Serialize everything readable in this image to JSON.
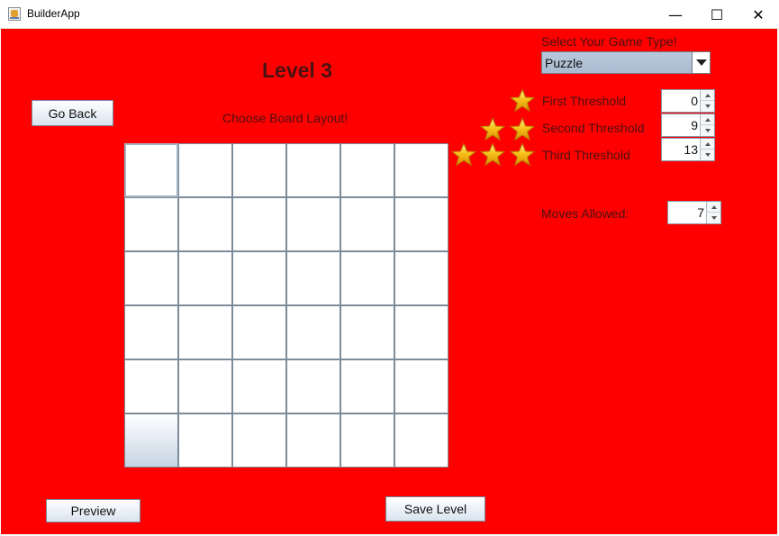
{
  "window": {
    "title": "BuilderApp"
  },
  "controls": {
    "minimize": "—",
    "maximize": "☐",
    "close": "✕"
  },
  "level": {
    "title": "Level 3"
  },
  "buttons": {
    "go_back": "Go Back",
    "preview": "Preview",
    "save_level": "Save Level"
  },
  "board": {
    "label": "Choose Board Layout!",
    "rows": 6,
    "columns": 6
  },
  "game_type": {
    "label": "Select Your Game Type!",
    "selected": "Puzzle"
  },
  "thresholds": [
    {
      "label": "First Threshold",
      "value": "0",
      "stars": 1
    },
    {
      "label": "Second Threshold",
      "value": "9",
      "stars": 2
    },
    {
      "label": "Third Threshold",
      "value": "13",
      "stars": 3
    }
  ],
  "moves": {
    "label": "Moves Allowed:",
    "value": "7"
  },
  "colors": {
    "background": "#ff0000",
    "text": "#4a1212",
    "star": "#f5b400"
  },
  "icons": {
    "star": "gold-star-icon",
    "app": "java-app-icon"
  }
}
